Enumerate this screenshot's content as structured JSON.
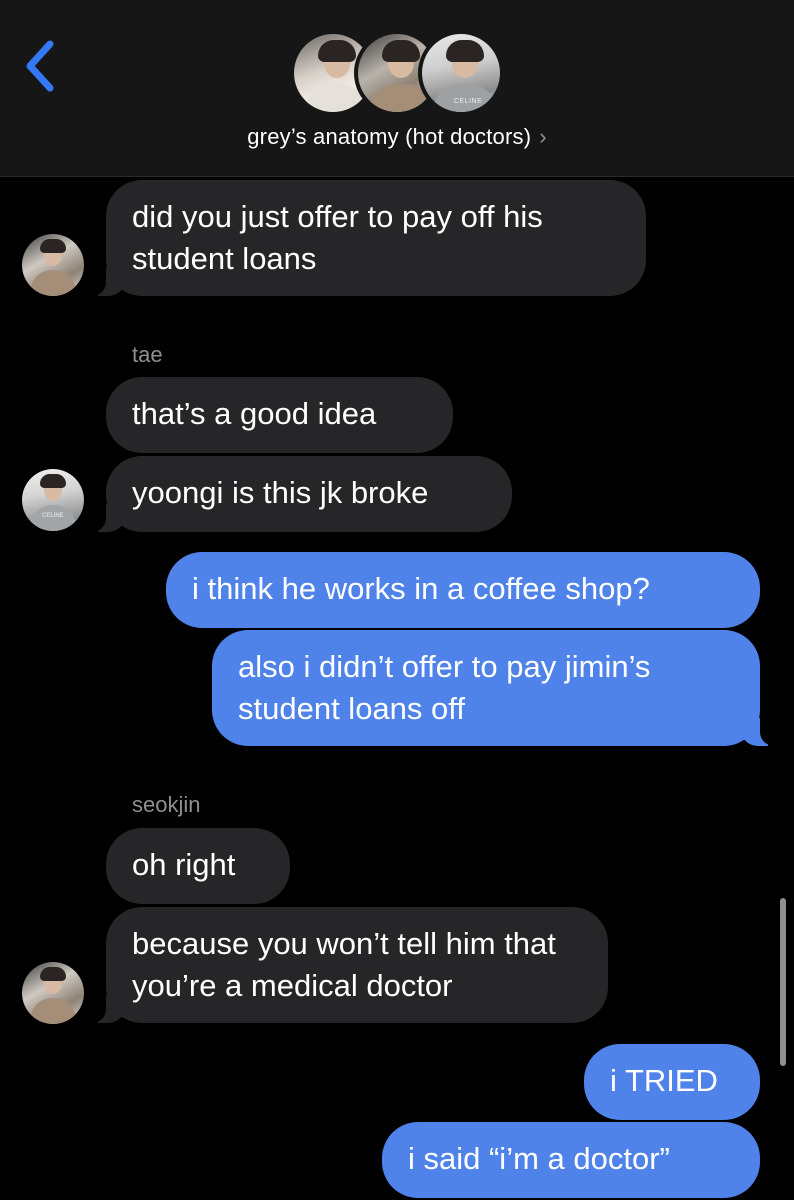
{
  "header": {
    "back_icon": "chevron-left-icon",
    "title": "grey’s anatomy (hot doctors)",
    "title_chevron": "›",
    "accent": "#3478f6",
    "member_avatars": [
      "group-avatar-1",
      "group-avatar-2",
      "group-avatar-3"
    ],
    "celine": "CELINE"
  },
  "messages": {
    "m1": "did you just offer to pay off his student loans",
    "sender_tae": "tae",
    "m2": "that’s a good idea",
    "m3": "yoongi is this jk broke",
    "m4": "i think he works in a coffee shop?",
    "m5": "also i didn’t offer to pay jimin’s student loans off",
    "sender_seokjin": "seokjin",
    "m6": "oh right",
    "m7": "because you won’t tell him that you’re a medical doctor",
    "m8": "i TRIED",
    "m9": "i said “i’m a doctor”"
  },
  "colors": {
    "incoming_bubble": "#262628",
    "outgoing_bubble": "#4f83e9",
    "background": "#000000",
    "header_bg": "#161616"
  }
}
